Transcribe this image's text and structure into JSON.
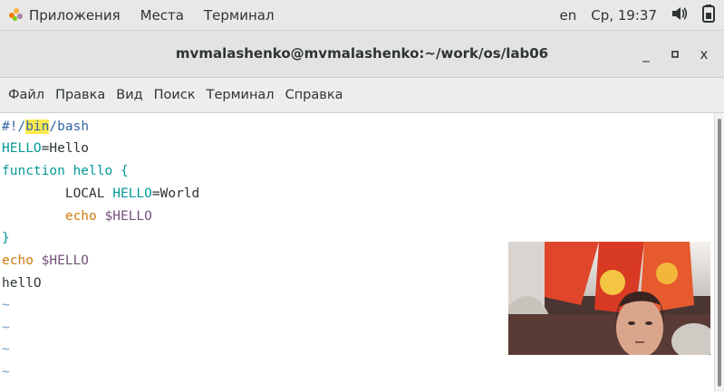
{
  "topbar": {
    "apps": "Приложения",
    "places": "Места",
    "terminal": "Терминал",
    "lang": "en",
    "clock": "Ср, 19:37",
    "volume_icon": "volume-icon",
    "battery_icon": "battery-icon"
  },
  "window": {
    "title": "mvmalashenko@mvmalashenko:~/work/os/lab06",
    "minimize": "_",
    "maximize": "▫",
    "close": "x"
  },
  "menu": [
    "Файл",
    "Правка",
    "Вид",
    "Поиск",
    "Терминал",
    "Справка"
  ],
  "editor": {
    "shebang_prefix": "#!/",
    "shebang_bin": "bin",
    "shebang_suffix": "/bash",
    "l2_var": "HELLO",
    "l2_rest": "=Hello",
    "l3": "function hello {",
    "l4_indent": "        ",
    "l4_local": "LOCAL",
    "l4_space": " ",
    "l4_var": "HELLO",
    "l4_rest": "=World",
    "l5_indent": "        ",
    "l5_echo": "echo",
    "l5_space": " ",
    "l5_var": "$HELLO",
    "l6": "}",
    "l7_echo": "echo",
    "l7_space": " ",
    "l7_var": "$HELLO",
    "l8": "hellO",
    "tilde": "~"
  },
  "colors": {
    "teal": "#06989a",
    "blue": "#3465a4",
    "orange": "#c4a000",
    "purple": "#75507b",
    "highlight": "#fce94f"
  }
}
